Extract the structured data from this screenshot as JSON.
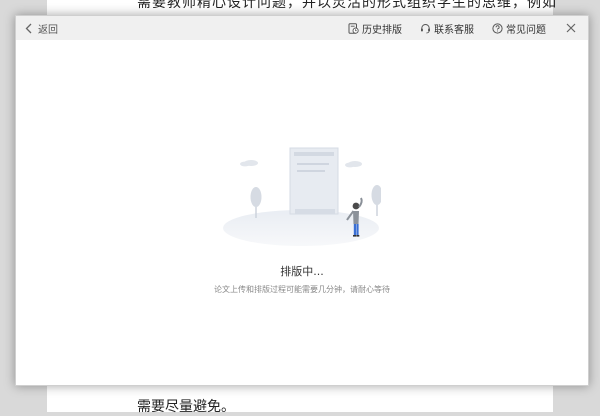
{
  "background": {
    "top_text": "需要教师精心设计问题，并以灵活的形式组织学生的思维，例如",
    "bottom_text": "需要尽量避免。"
  },
  "toolbar": {
    "back_label": "返回",
    "history_label": "历史排版",
    "support_label": "联系客服",
    "faq_label": "常见问题"
  },
  "main": {
    "status": "排版中...",
    "hint": "论文上传和排版过程可能需要几分钟，请耐心等待"
  },
  "icons": {
    "back": "chevron-left-icon",
    "history": "history-icon",
    "support": "headset-icon",
    "faq": "question-icon",
    "close": "close-icon"
  }
}
